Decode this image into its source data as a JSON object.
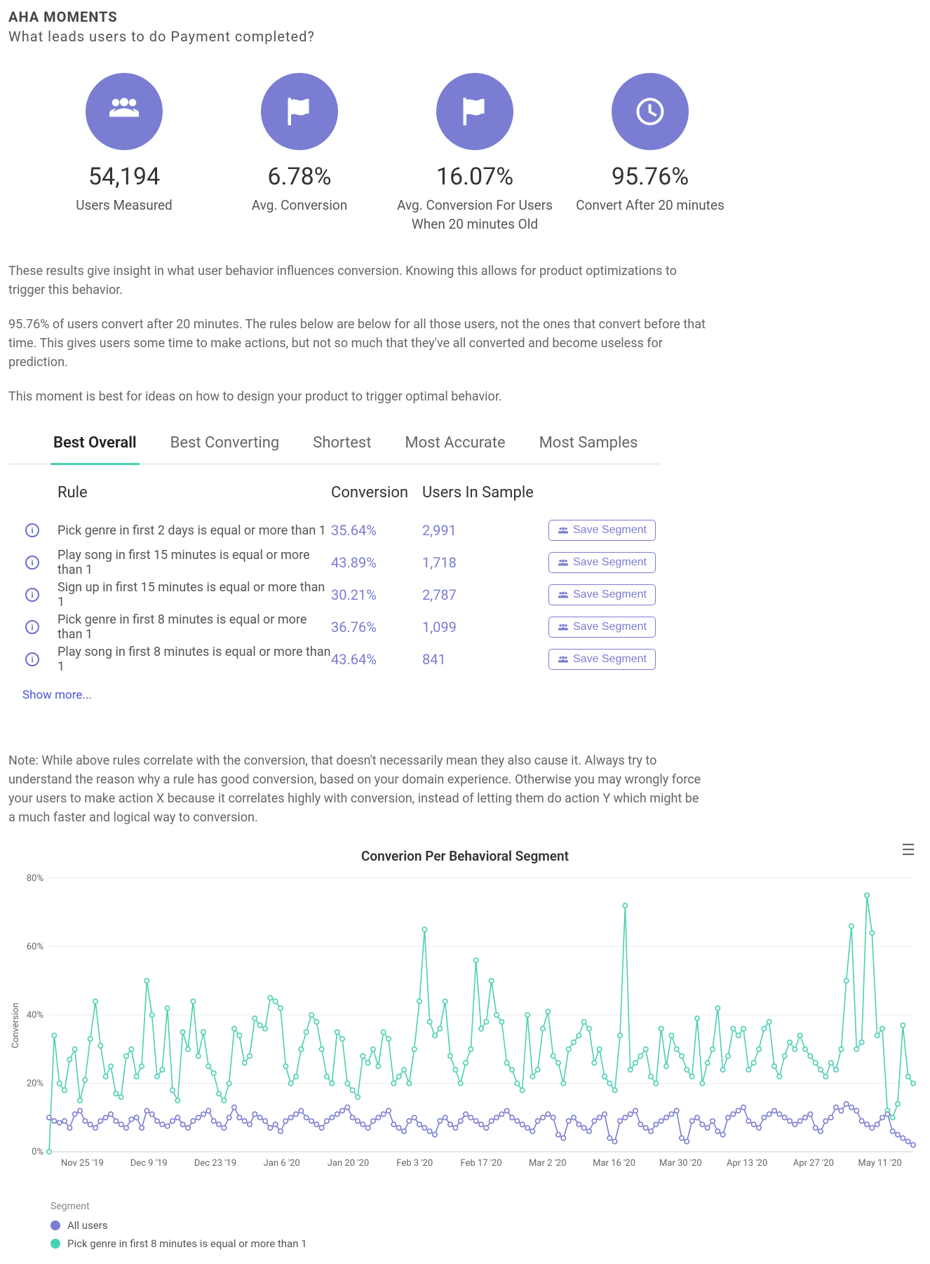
{
  "header": {
    "title": "AHA MOMENTS",
    "subtitle": "What leads users to do Payment completed?"
  },
  "stats": [
    {
      "icon": "users-icon",
      "value": "54,194",
      "label": "Users Measured"
    },
    {
      "icon": "flag-icon",
      "value": "6.78%",
      "label": "Avg. Conversion"
    },
    {
      "icon": "flag-icon",
      "value": "16.07%",
      "label": "Avg. Conversion For Users When 20 minutes Old"
    },
    {
      "icon": "clock-icon",
      "value": "95.76%",
      "label": "Convert After 20 minutes"
    }
  ],
  "explain": {
    "p1": "These results give insight in what user behavior influences conversion. Knowing this allows for product optimizations to trigger this behavior.",
    "p2": "95.76% of users convert after 20 minutes. The rules below are below for all those users, not the ones that convert before that time. This gives users some time to make actions, but not so much that they've all converted and become useless for prediction.",
    "p3": "This moment is best for ideas on how to design your product to trigger optimal behavior."
  },
  "tabs": [
    "Best Overall",
    "Best Converting",
    "Shortest",
    "Most Accurate",
    "Most Samples"
  ],
  "active_tab": 0,
  "table": {
    "columns": {
      "rule": "Rule",
      "conversion": "Conversion",
      "users": "Users In Sample"
    },
    "save_label": "Save Segment",
    "rows": [
      {
        "rule": "Pick genre in first 2 days is equal or more than 1",
        "conversion": "35.64%",
        "users": "2,991"
      },
      {
        "rule": "Play song in first 15 minutes is equal or more than 1",
        "conversion": "43.89%",
        "users": "1,718"
      },
      {
        "rule": "Sign up in first 15 minutes is equal or more than 1",
        "conversion": "30.21%",
        "users": "2,787"
      },
      {
        "rule": "Pick genre in first 8 minutes is equal or more than 1",
        "conversion": "36.76%",
        "users": "1,099"
      },
      {
        "rule": "Play song in first 8 minutes is equal or more than 1",
        "conversion": "43.64%",
        "users": "841"
      }
    ],
    "show_more": "Show more..."
  },
  "note": "Note: While above rules correlate with the conversion, that doesn't necessarily mean they also cause it. Always try to understand the reason why a rule has good conversion, based on your domain experience. Otherwise you may wrongly force your users to make action X because it correlates highly with conversion, instead of letting them do action Y which might be a much faster and logical way to conversion.",
  "chart_data": {
    "type": "line",
    "title": "Converion Per Behavioral Segment",
    "ylabel": "Conversion",
    "ylim": [
      0,
      80
    ],
    "yticks": [
      "0%",
      "20%",
      "40%",
      "60%",
      "80%"
    ],
    "xticks": [
      "Nov 25 '19",
      "Dec 9 '19",
      "Dec 23 '19",
      "Jan 6 '20",
      "Jan 20 '20",
      "Feb 3 '20",
      "Feb 17 '20",
      "Mar 2 '20",
      "Mar 16 '20",
      "Mar 30 '20",
      "Apr 13 '20",
      "Apr 27 '20",
      "May 11 '20"
    ],
    "legend_title": "Segment",
    "colors": {
      "all": "#7a7dd1",
      "segment": "#4ad0b2"
    },
    "series": [
      {
        "name": "All users",
        "color": "#7a7dd1",
        "values": [
          10,
          9,
          8.5,
          9,
          7,
          11,
          12,
          9,
          8,
          7,
          9,
          10,
          11,
          9,
          8,
          7,
          9.5,
          10,
          7,
          12,
          11,
          9,
          8,
          7.5,
          9,
          10,
          8,
          7,
          9,
          10,
          11,
          12,
          9,
          8,
          7,
          10,
          13,
          10,
          9,
          8,
          11,
          10,
          9,
          7,
          8,
          6,
          9,
          10,
          11,
          12,
          10,
          9,
          8,
          7,
          9,
          10,
          11,
          12,
          13,
          10,
          9,
          8,
          7,
          9,
          10,
          11,
          12,
          8,
          7,
          6,
          9,
          10,
          8,
          7,
          6,
          5,
          9,
          10,
          8,
          7,
          9,
          11,
          10,
          9,
          8,
          7,
          9,
          10,
          11,
          12,
          10,
          9,
          8,
          7,
          6,
          9,
          10,
          11,
          10,
          5,
          4,
          9,
          10,
          8,
          7,
          6,
          9,
          10,
          11,
          4,
          3,
          9,
          10,
          11,
          12,
          8,
          7,
          6,
          8,
          9,
          10,
          11,
          12,
          4,
          3,
          9,
          10,
          8,
          7,
          9,
          6,
          5,
          10,
          11,
          12,
          13,
          9,
          8,
          7,
          10,
          11,
          12,
          11,
          10,
          9,
          8,
          9,
          10,
          11,
          7,
          6,
          9,
          10,
          13,
          12,
          14,
          13,
          12,
          9,
          8,
          7,
          8,
          10,
          11,
          6,
          5,
          4,
          3,
          2
        ]
      },
      {
        "name": "Pick genre in first 8 minutes is equal or more than 1",
        "color": "#4ad0b2",
        "values": [
          0,
          34,
          20,
          18,
          27,
          30,
          15,
          21,
          33,
          44,
          31,
          22,
          25,
          17,
          16,
          28,
          30,
          22,
          25,
          50,
          40,
          22,
          24,
          42,
          18,
          15,
          35,
          30,
          44,
          28,
          35,
          25,
          23,
          17,
          15,
          20,
          36,
          34,
          26,
          28,
          39,
          37,
          36,
          45,
          44,
          42,
          25,
          20,
          22,
          30,
          35,
          40,
          38,
          30,
          22,
          20,
          35,
          33,
          20,
          18,
          16,
          28,
          26,
          30,
          25,
          35,
          33,
          20,
          22,
          24,
          20,
          30,
          44,
          65,
          38,
          34,
          36,
          44,
          28,
          24,
          20,
          26,
          30,
          56,
          36,
          38,
          50,
          40,
          38,
          26,
          24,
          20,
          18,
          40,
          22,
          24,
          36,
          41,
          28,
          26,
          20,
          30,
          32,
          34,
          38,
          36,
          26,
          30,
          22,
          20,
          18,
          34,
          72,
          24,
          26,
          28,
          30,
          22,
          20,
          36,
          25,
          34,
          30,
          28,
          24,
          22,
          39,
          20,
          26,
          30,
          42,
          24,
          28,
          36,
          34,
          36,
          24,
          26,
          30,
          36,
          38,
          25,
          22,
          28,
          32,
          30,
          34,
          30,
          28,
          26,
          24,
          22,
          26,
          24,
          30,
          50,
          66,
          30,
          32,
          75,
          64,
          34,
          36,
          12,
          10,
          14,
          37,
          22,
          20
        ]
      }
    ]
  }
}
